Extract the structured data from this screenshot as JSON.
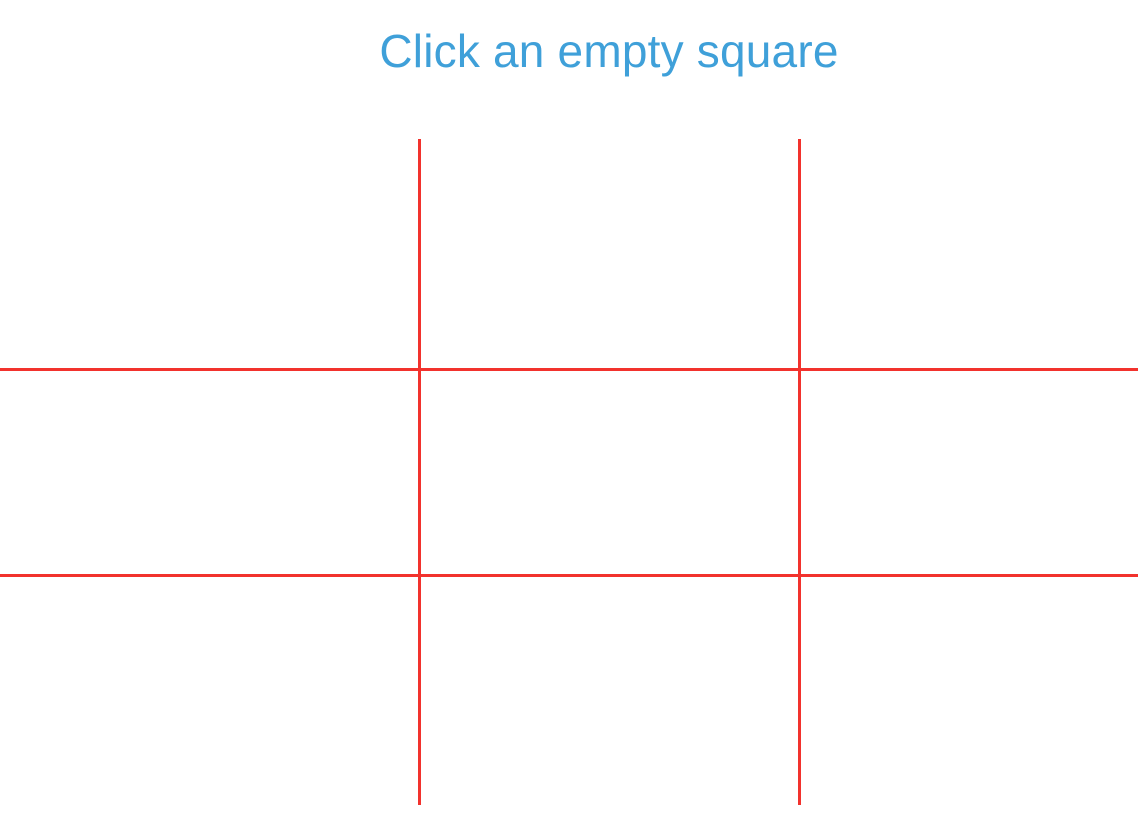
{
  "status": {
    "message": "Click an empty square"
  },
  "board": {
    "rows": 3,
    "columns": 3,
    "cells": [
      "",
      "",
      "",
      "",
      "",
      "",
      "",
      "",
      ""
    ]
  },
  "colors": {
    "status_text": "#3fa0d9",
    "grid_lines": "#f2322d",
    "background": "#ffffff"
  }
}
